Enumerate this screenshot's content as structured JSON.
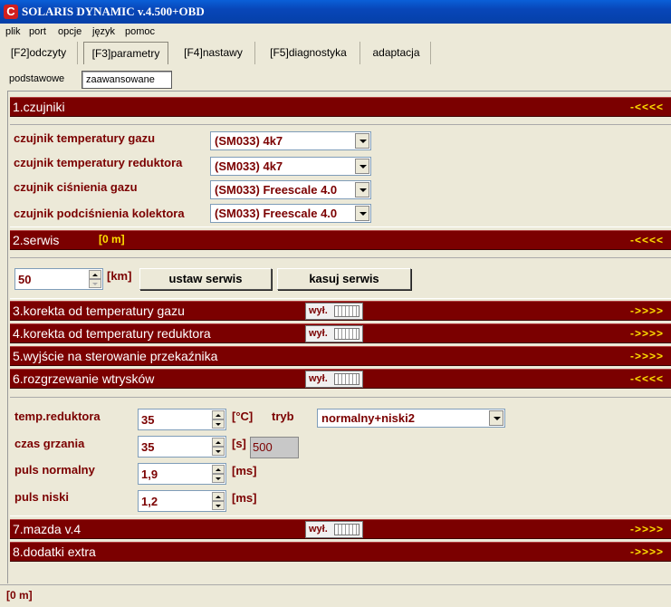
{
  "window": {
    "title": "SOLARIS DYNAMIC v.4.500+OBD",
    "icon": "app-logo-icon"
  },
  "menu": [
    "plik",
    "port",
    "opcje",
    "język",
    "pomoc"
  ],
  "tabs": [
    "[F2]odczyty",
    "[F3]parametry",
    "[F4]nastawy",
    "[F5]diagnostyka",
    "adaptacja"
  ],
  "active_tab": "[F3]parametry",
  "subtabs": [
    "podstawowe",
    "zaawansowane"
  ],
  "active_subtab": "zaawansowane",
  "sections": {
    "s1": {
      "title": "1.czujniki",
      "arrow": "-<<<<"
    },
    "s2": {
      "title": "2.serwis",
      "extra": "[0 m]",
      "arrow": "-<<<<"
    },
    "s3": {
      "title": "3.korekta od temperatury gazu",
      "toggle": "wył.",
      "arrow": "->>>>"
    },
    "s4": {
      "title": "4.korekta od temperatury reduktora",
      "toggle": "wył.",
      "arrow": "->>>>"
    },
    "s5": {
      "title": "5.wyjście na sterowanie przekaźnika",
      "arrow": "->>>>"
    },
    "s6": {
      "title": "6.rozgrzewanie wtrysków",
      "toggle": "wył.",
      "arrow": "-<<<<"
    },
    "s7": {
      "title": "7.mazda v.4",
      "toggle": "wył.",
      "arrow": "->>>>"
    },
    "s8": {
      "title": "8.dodatki extra",
      "arrow": "->>>>"
    }
  },
  "sensors": [
    {
      "label": "czujnik temperatury gazu",
      "value": "(SM033) 4k7"
    },
    {
      "label": "czujnik temperatury reduktora",
      "value": "(SM033) 4k7"
    },
    {
      "label": "czujnik ciśnienia gazu",
      "value": "(SM033) Freescale 4.0"
    },
    {
      "label": "czujnik podciśnienia kolektora",
      "value": "(SM033) Freescale 4.0"
    }
  ],
  "service": {
    "value": "50",
    "unit": "[km]",
    "set_label": "ustaw serwis",
    "clear_label": "kasuj serwis"
  },
  "warmup": {
    "temp_label": "temp.reduktora",
    "temp_value": "35",
    "temp_unit": "[°C]",
    "mode_label": "tryb",
    "mode_value": "normalny+niski2",
    "time_label": "czas grzania",
    "time_value": "35",
    "time_unit": "[s]",
    "time_readonly": "500",
    "pulse_normal_label": "puls normalny",
    "pulse_normal_value": "1,9",
    "pulse_normal_unit": "[ms]",
    "pulse_low_label": "puls niski",
    "pulse_low_value": "1,2",
    "pulse_low_unit": "[ms]"
  },
  "status": "[0 m]",
  "colors": {
    "section_bar": "#7b0000",
    "arrow": "#ffe000",
    "value_text": "#7b0000"
  }
}
